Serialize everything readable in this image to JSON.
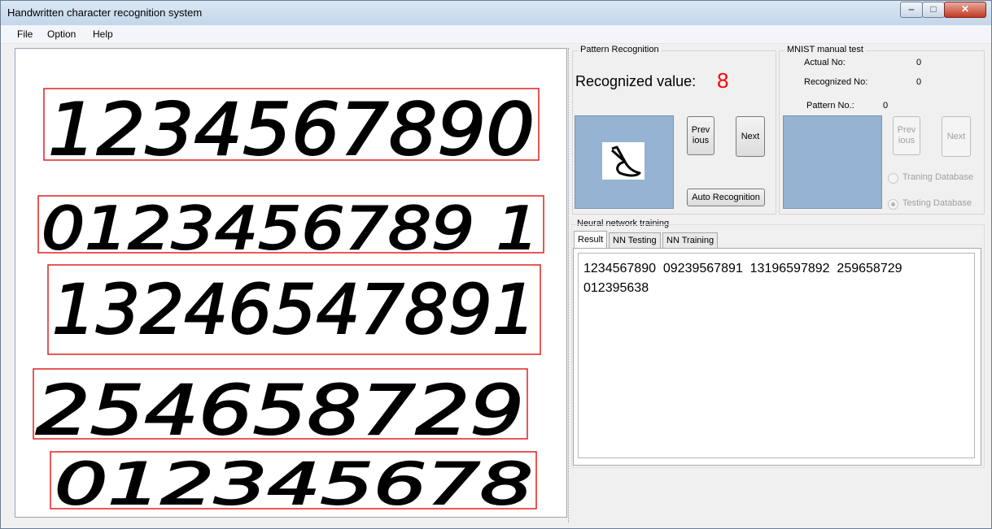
{
  "window": {
    "title": "Handwritten character recognition system",
    "controls": {
      "minimize": "‒",
      "maximize": "□",
      "close": "✕"
    }
  },
  "menu": {
    "items": [
      "File",
      "Option",
      "Help"
    ]
  },
  "canvas": {
    "rows": [
      "1234567890",
      "0123456789 1",
      "13246547891",
      "254658729",
      "012345678"
    ],
    "ink_color": "#000000",
    "box_color": "#e02020"
  },
  "pattern_recognition": {
    "label": "Pattern Recognition",
    "recognized_label": "Recognized value:",
    "recognized_value": "8",
    "value_color": "#ff0000",
    "previous_button": "Prev\nious",
    "next_button": "Next",
    "auto_button": "Auto Recognition"
  },
  "mnist": {
    "label": "MNIST manual test",
    "actual_label": "Actual No:",
    "actual_value": "0",
    "recognized_label": "Recognized No:",
    "recognized_value": "0",
    "pattern_label": "Pattern No.:",
    "pattern_value": "0",
    "previous_button": "Prev\nious",
    "next_button": "Next",
    "training_db": "Traning Database",
    "testing_db": "Testing Database"
  },
  "nn": {
    "label": "Neural network training",
    "tabs": [
      "Result",
      "NN Testing",
      "NN Training"
    ],
    "result_text": "1234567890  09239567891  13196597892  259658729\n012395638"
  }
}
